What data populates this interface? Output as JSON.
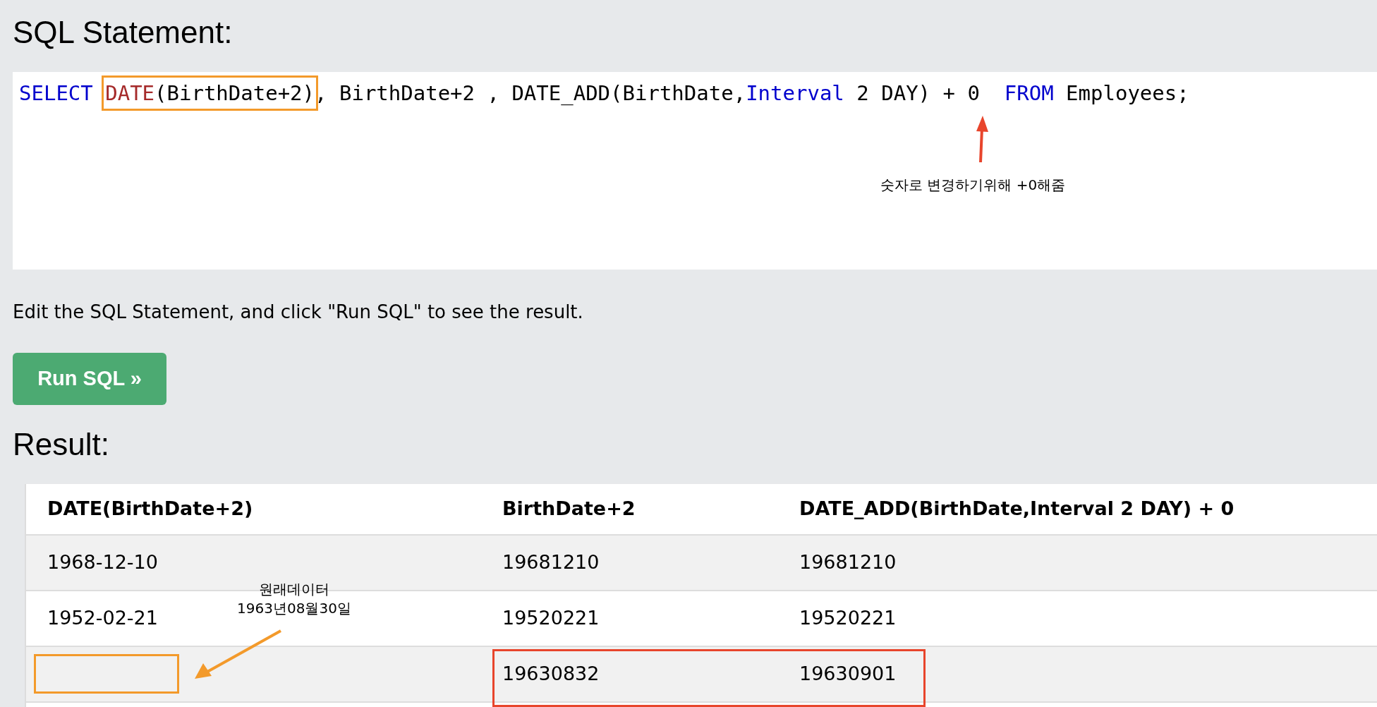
{
  "sql_heading": "SQL Statement:",
  "code": [
    {
      "kind": "keyword",
      "text": "SELECT "
    },
    {
      "kind": "highlight",
      "tokens": [
        {
          "kind": "function",
          "text": "DATE"
        },
        {
          "kind": "plain",
          "text": "(BirthDate+2)"
        }
      ]
    },
    {
      "kind": "plain",
      "text": ", BirthDate+2 , DATE_ADD(BirthDate,"
    },
    {
      "kind": "keyword",
      "text": "Interval"
    },
    {
      "kind": "plain",
      "text": " 2 DAY) + 0  "
    },
    {
      "kind": "keyword",
      "text": "FROM"
    },
    {
      "kind": "plain",
      "text": " Employees;"
    }
  ],
  "code_note": {
    "text": "숫자로 변경하기위해 +0해줌",
    "color": "#e8452c"
  },
  "hint": "Edit the SQL Statement, and click \"Run SQL\" to see the result.",
  "run_button": "Run SQL »",
  "result_heading": "Result:",
  "table": {
    "columns": [
      "DATE(BirthDate+2)",
      "BirthDate+2",
      "DATE_ADD(BirthDate,Interval 2 DAY) + 0"
    ],
    "rows": [
      {
        "cells": [
          "1968-12-10",
          "19681210",
          "19681210"
        ],
        "empty_marker": false,
        "compare_box": false
      },
      {
        "cells": [
          "1952-02-21",
          "19520221",
          "19520221"
        ],
        "empty_marker": false,
        "compare_box": false
      },
      {
        "cells": [
          null,
          "19630832",
          "19630901"
        ],
        "empty_marker": true,
        "compare_box": true
      }
    ]
  },
  "table_note": {
    "lines": [
      "원래데이터",
      "1963년08월30일"
    ],
    "color": "#f39a2b"
  }
}
